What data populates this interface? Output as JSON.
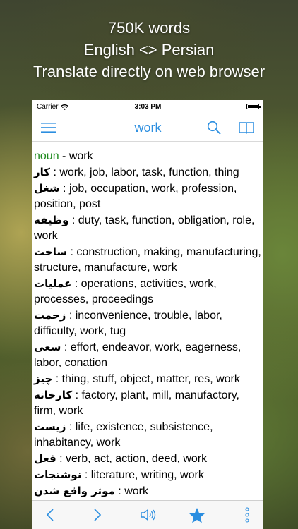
{
  "promo": {
    "line1": "750K words",
    "line2": "English <> Persian",
    "line3": "Translate directly on web browser"
  },
  "status_bar": {
    "carrier": "Carrier",
    "time": "3:03 PM"
  },
  "nav": {
    "title": "work"
  },
  "definition": {
    "pos": "noun",
    "headword": " - work",
    "entries": [
      {
        "fa": "کار",
        "en": " : work, job, labor, task, function, thing"
      },
      {
        "fa": "شغل",
        "en": " : job, occupation, work, profession, position, post"
      },
      {
        "fa": "وظیفه",
        "en": " : duty, task, function, obligation, role, work"
      },
      {
        "fa": "ساخت",
        "en": " : construction, making, manufacturing, structure, manufacture, work"
      },
      {
        "fa": "عملیات",
        "en": " : operations, activities, work, processes, proceedings"
      },
      {
        "fa": "زحمت",
        "en": " : inconvenience, trouble, labor, difficulty, work, tug"
      },
      {
        "fa": "سعی",
        "en": " : effort, endeavor, work, eagerness, labor, conation"
      },
      {
        "fa": "چیز",
        "en": " : thing, stuff, object, matter, res, work"
      },
      {
        "fa": "کارخانه",
        "en": " : factory, plant, mill, manufactory, firm, work"
      },
      {
        "fa": "زیست",
        "en": " : life, existence, subsistence, inhabitancy, work"
      },
      {
        "fa": "فعل",
        "en": " : verb, act, action, deed, work"
      },
      {
        "fa": "نوشتجات",
        "en": " : literature, writing, work"
      },
      {
        "fa": "موثر واقع شدن",
        "en": " : work"
      }
    ]
  },
  "icons": {
    "accent": "#2b8ee0"
  }
}
